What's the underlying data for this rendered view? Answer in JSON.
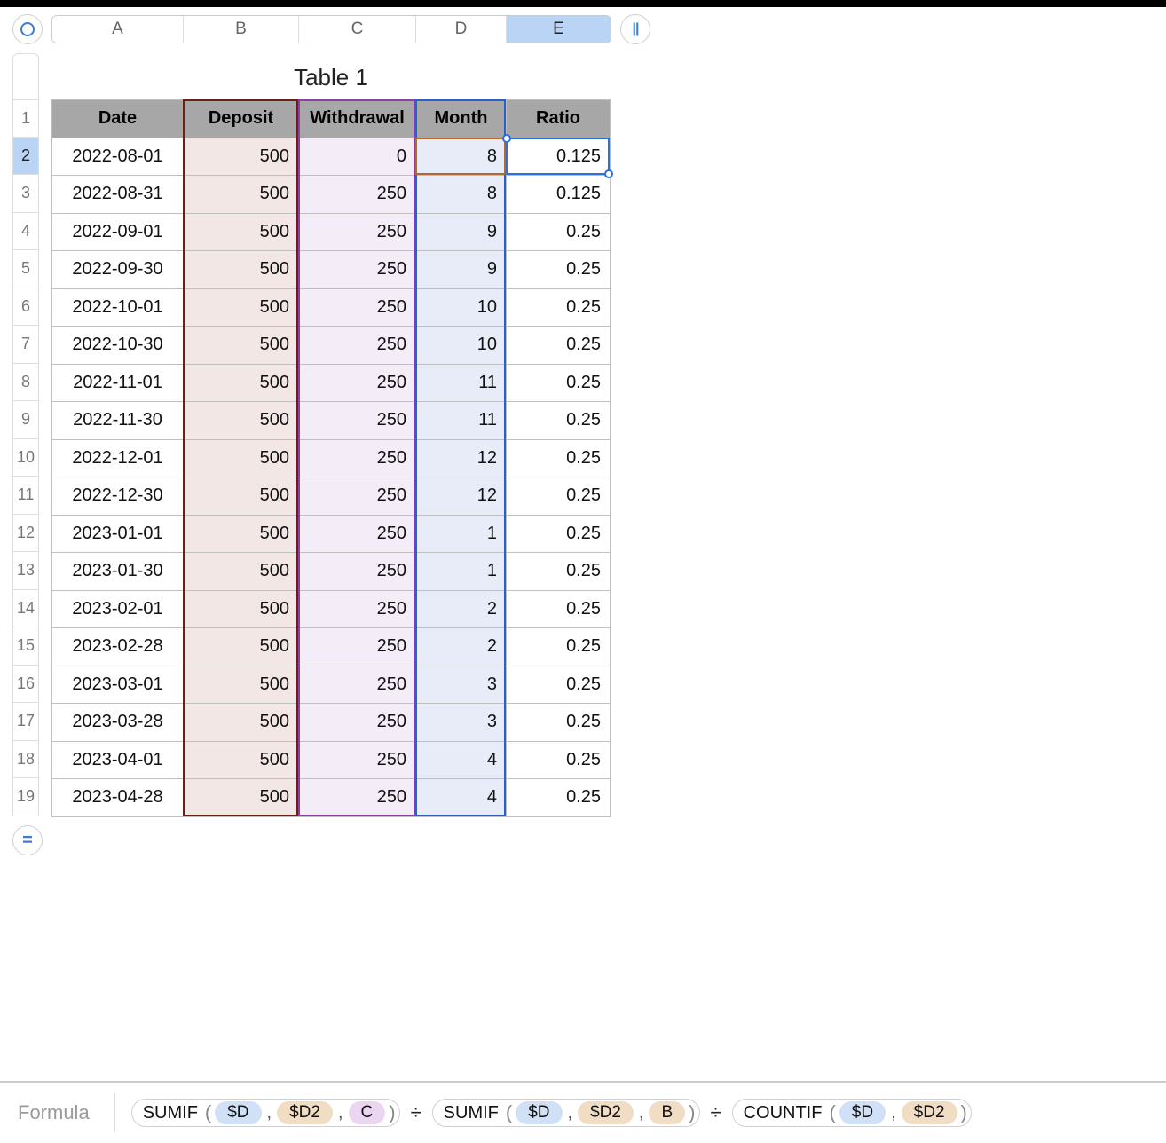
{
  "table_title": "Table 1",
  "columns": [
    "A",
    "B",
    "C",
    "D",
    "E"
  ],
  "selected_column": "E",
  "selected_row": "2",
  "row_numbers": [
    "1",
    "2",
    "3",
    "4",
    "5",
    "6",
    "7",
    "8",
    "9",
    "10",
    "11",
    "12",
    "13",
    "14",
    "15",
    "16",
    "17",
    "18",
    "19"
  ],
  "headers": {
    "A": "Date",
    "B": "Deposit",
    "C": "Withdrawal",
    "D": "Month",
    "E": "Ratio"
  },
  "rows": [
    {
      "A": "2022-08-01",
      "B": "500",
      "C": "0",
      "D": "8",
      "E": "0.125"
    },
    {
      "A": "2022-08-31",
      "B": "500",
      "C": "250",
      "D": "8",
      "E": "0.125"
    },
    {
      "A": "2022-09-01",
      "B": "500",
      "C": "250",
      "D": "9",
      "E": "0.25"
    },
    {
      "A": "2022-09-30",
      "B": "500",
      "C": "250",
      "D": "9",
      "E": "0.25"
    },
    {
      "A": "2022-10-01",
      "B": "500",
      "C": "250",
      "D": "10",
      "E": "0.25"
    },
    {
      "A": "2022-10-30",
      "B": "500",
      "C": "250",
      "D": "10",
      "E": "0.25"
    },
    {
      "A": "2022-11-01",
      "B": "500",
      "C": "250",
      "D": "11",
      "E": "0.25"
    },
    {
      "A": "2022-11-30",
      "B": "500",
      "C": "250",
      "D": "11",
      "E": "0.25"
    },
    {
      "A": "2022-12-01",
      "B": "500",
      "C": "250",
      "D": "12",
      "E": "0.25"
    },
    {
      "A": "2022-12-30",
      "B": "500",
      "C": "250",
      "D": "12",
      "E": "0.25"
    },
    {
      "A": "2023-01-01",
      "B": "500",
      "C": "250",
      "D": "1",
      "E": "0.25"
    },
    {
      "A": "2023-01-30",
      "B": "500",
      "C": "250",
      "D": "1",
      "E": "0.25"
    },
    {
      "A": "2023-02-01",
      "B": "500",
      "C": "250",
      "D": "2",
      "E": "0.25"
    },
    {
      "A": "2023-02-28",
      "B": "500",
      "C": "250",
      "D": "2",
      "E": "0.25"
    },
    {
      "A": "2023-03-01",
      "B": "500",
      "C": "250",
      "D": "3",
      "E": "0.25"
    },
    {
      "A": "2023-03-28",
      "B": "500",
      "C": "250",
      "D": "3",
      "E": "0.25"
    },
    {
      "A": "2023-04-01",
      "B": "500",
      "C": "250",
      "D": "4",
      "E": "0.25"
    },
    {
      "A": "2023-04-28",
      "B": "500",
      "C": "250",
      "D": "4",
      "E": "0.25"
    }
  ],
  "formula_bar": {
    "label": "Formula",
    "tokens": [
      {
        "type": "fn",
        "name": "SUMIF",
        "args": [
          {
            "t": "ref",
            "v": "$D",
            "c": "blue"
          },
          {
            "t": "ref",
            "v": "$D2",
            "c": "tan"
          },
          {
            "t": "ref",
            "v": "C",
            "c": "purple"
          }
        ]
      },
      {
        "type": "op",
        "v": "÷"
      },
      {
        "type": "fn",
        "name": "SUMIF",
        "args": [
          {
            "t": "ref",
            "v": "$D",
            "c": "blue"
          },
          {
            "t": "ref",
            "v": "$D2",
            "c": "tan"
          },
          {
            "t": "ref",
            "v": "B",
            "c": "tan"
          }
        ]
      },
      {
        "type": "op",
        "v": "÷"
      },
      {
        "type": "fn",
        "name": "COUNTIF",
        "args": [
          {
            "t": "ref",
            "v": "$D",
            "c": "blue"
          },
          {
            "t": "ref",
            "v": "$D2",
            "c": "tan"
          }
        ]
      }
    ]
  },
  "colors": {
    "accent_blue": "#2e6fe0",
    "col_b_border": "#6b1f17",
    "col_c_border": "#8a3fa6",
    "col_d_border": "#2e5fc9",
    "d2_ring": "#b06a2c"
  }
}
